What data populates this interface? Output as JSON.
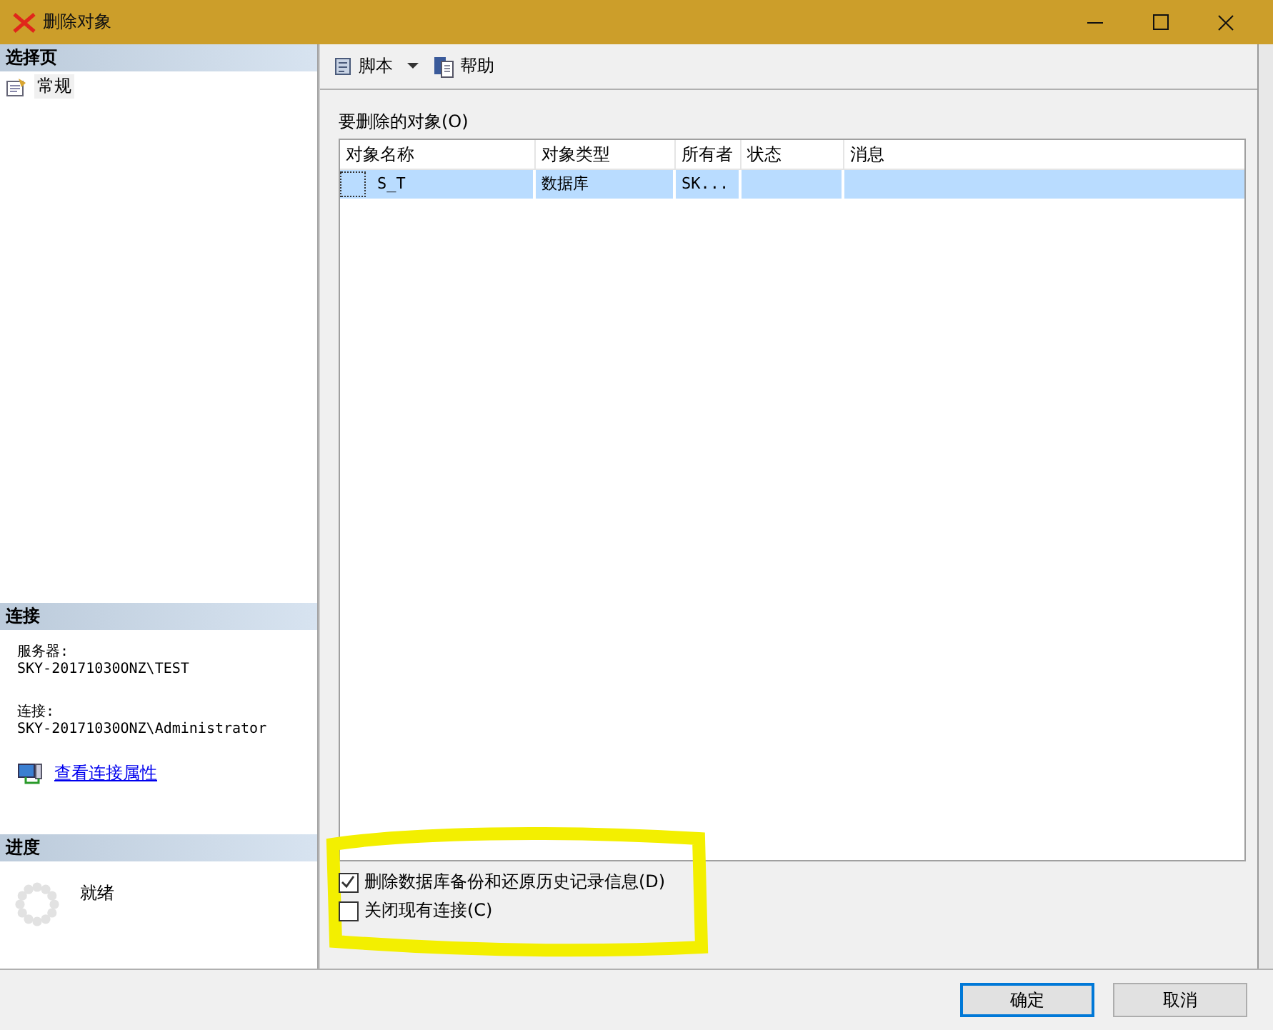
{
  "window": {
    "title": "删除对象"
  },
  "select_page": {
    "header": "选择页",
    "items": [
      {
        "label": "常规",
        "selected": true
      }
    ]
  },
  "connection": {
    "header": "连接",
    "server_label": "服务器:",
    "server": "SKY-20171030ONZ\\TEST",
    "connection_label": "连接:",
    "connection": "SKY-20171030ONZ\\Administrator",
    "link": "查看连接属性"
  },
  "progress": {
    "header": "进度",
    "status": "就绪"
  },
  "toolbar": {
    "script": "脚本",
    "help": "帮助"
  },
  "objects": {
    "label": "要删除的对象(O)",
    "columns": [
      "对象名称",
      "对象类型",
      "所有者",
      "状态",
      "消息"
    ],
    "rows": [
      {
        "cells": [
          "S_T",
          "数据库",
          "SK...",
          "",
          ""
        ],
        "selected": true
      }
    ]
  },
  "options": [
    {
      "label": "删除数据库备份和还原历史记录信息(D)",
      "checked": true
    },
    {
      "label": "关闭现有连接(C)",
      "checked": false
    }
  ],
  "buttons": [
    {
      "label": "确定",
      "default": true
    },
    {
      "label": "取消",
      "default": false
    }
  ]
}
